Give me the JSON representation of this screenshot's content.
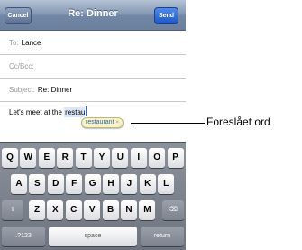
{
  "nav": {
    "cancel": "Cancel",
    "title": "Re: Dinner",
    "send": "Send"
  },
  "fields": {
    "to_label": "To:",
    "to_value": "Lance",
    "ccbcc_label": "Cc/Bcc:",
    "subject_label": "Subject:",
    "subject_value": "Re: Dinner"
  },
  "body": {
    "text_before": "Let's meet at the ",
    "typed": "restau"
  },
  "suggestion": {
    "word": "restaurant",
    "dismiss": "×"
  },
  "callout": "Foreslået ord",
  "keyboard": {
    "row1": [
      "Q",
      "W",
      "E",
      "R",
      "T",
      "Y",
      "U",
      "I",
      "O",
      "P"
    ],
    "row2": [
      "A",
      "S",
      "D",
      "F",
      "G",
      "H",
      "J",
      "K",
      "L"
    ],
    "row3": [
      "Z",
      "X",
      "C",
      "V",
      "B",
      "N",
      "M"
    ],
    "shift": "⇧",
    "delete": "⌫",
    "numbers": ".?123",
    "space": "space",
    "return": "return"
  }
}
